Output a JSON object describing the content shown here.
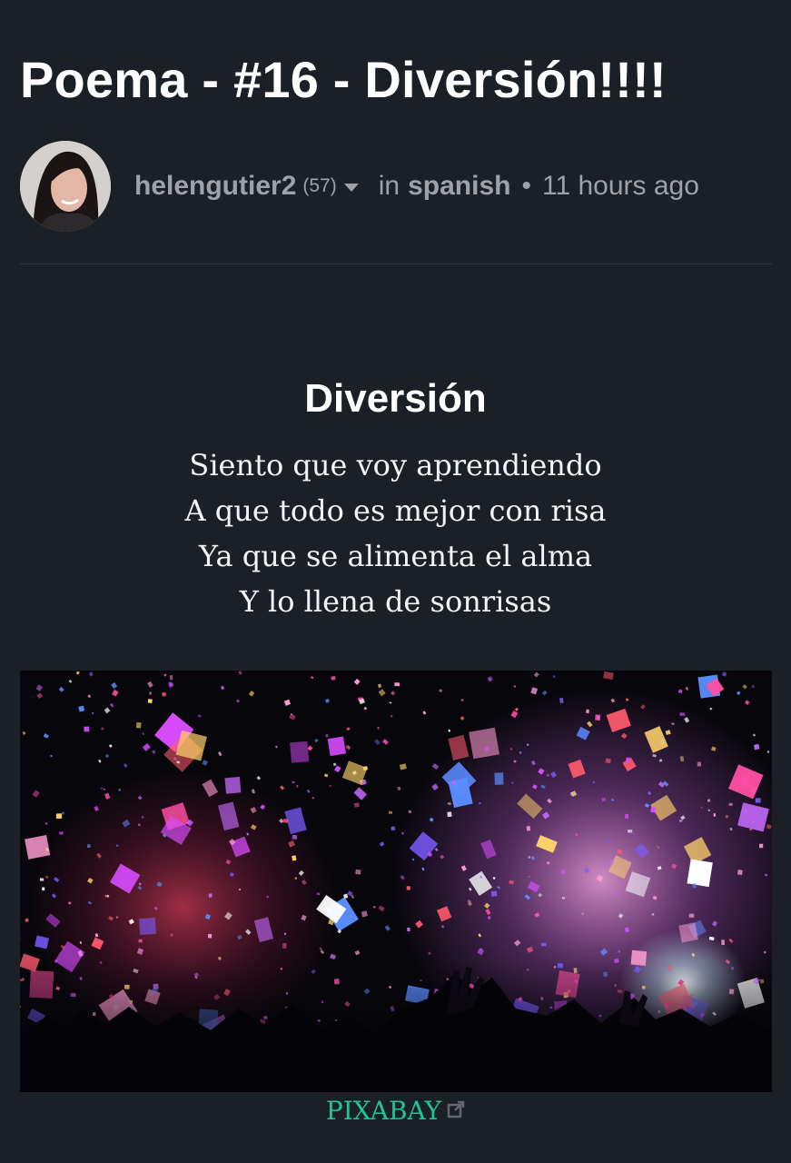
{
  "post": {
    "title": "Poema - #16 - Diversión!!!!"
  },
  "byline": {
    "author": "helengutier2",
    "reputation": "(57)",
    "in_word": "in",
    "community": "spanish",
    "separator": "•",
    "time": "11 hours ago",
    "icons": [
      "avatar",
      "chevron-down-icon"
    ]
  },
  "poem": {
    "title": "Diversión",
    "lines": [
      "Siento que voy aprendiendo",
      "A que todo es mejor con risa",
      "Ya que se alimenta el alma",
      "Y lo llena de sonrisas"
    ]
  },
  "image": {
    "source_label": "PIXABAY",
    "source_icon": "external-link-icon"
  },
  "colors": {
    "background": "#1b2026",
    "text": "#f2f4f5",
    "muted": "#9aa3ab",
    "link": "#1fc49a"
  }
}
